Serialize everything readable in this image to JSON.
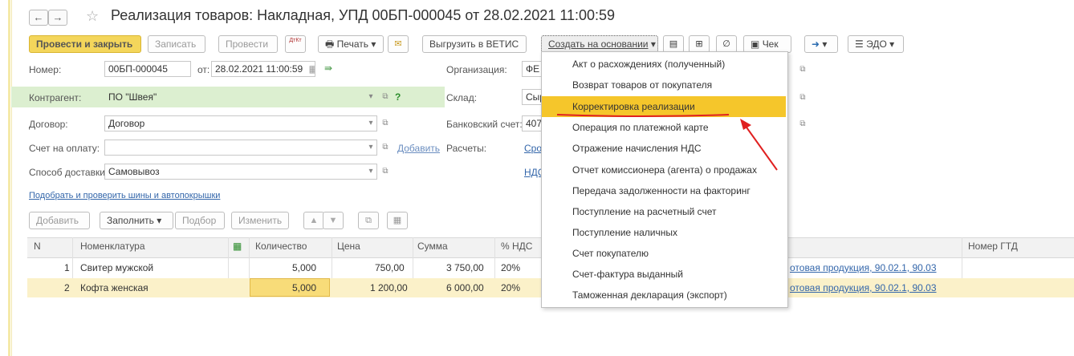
{
  "header": {
    "title": "Реализация товаров: Накладная, УПД 00БП-000045 от 28.02.2021 11:00:59",
    "back_arrow": "←",
    "forward_arrow": "→",
    "star_icon": "☆"
  },
  "toolbar": {
    "post_close": "Провести и закрыть",
    "save": "Записать",
    "post": "Провести",
    "dtkt": "ДтКт",
    "print": "Печать",
    "vetis": "Выгрузить в ВЕТИС",
    "create_based": "Создать на основании",
    "check": "Чек",
    "edo": "ЭДО"
  },
  "form": {
    "number_label": "Номер:",
    "number_value": "00БП-000045",
    "from_label": "от:",
    "date_value": "28.02.2021 11:00:59",
    "contractor_label": "Контрагент:",
    "contractor_value": "ПО \"Швея\"",
    "contract_label": "Договор:",
    "contract_value": "Договор",
    "invoice_label": "Счет на оплату:",
    "invoice_value": "",
    "add_link": "Добавить",
    "delivery_label": "Способ доставки:",
    "delivery_value": "Самовывоз",
    "tires_link": "Подобрать и проверить шины и автопокрышки",
    "org_label": "Организация:",
    "org_value": "ФЕ",
    "warehouse_label": "Склад:",
    "warehouse_value": "Сыр",
    "bank_label": "Банковский счет:",
    "bank_value": "407",
    "settlements_label": "Расчеты:",
    "settlements_link": "Сро",
    "vat_link": "НДС",
    "question": "?"
  },
  "table_toolbar": {
    "add": "Добавить",
    "fill": "Заполнить",
    "pick": "Подбор",
    "change": "Изменить"
  },
  "table": {
    "headers": {
      "n": "N",
      "item": "Номенклатура",
      "qty": "Количество",
      "price": "Цена",
      "sum": "Сумма",
      "vat": "% НДС",
      "gtd": "Номер ГТД"
    },
    "rows": [
      {
        "n": "1",
        "item": "Свитер мужской",
        "qty": "5,000",
        "price": "750,00",
        "sum": "3 750,00",
        "vat": "20%",
        "account": "отовая продукция, 90.02.1, 90.03"
      },
      {
        "n": "2",
        "item": "Кофта  женская",
        "qty": "5,000",
        "price": "1 200,00",
        "sum": "6 000,00",
        "vat": "20%",
        "account": "отовая продукция, 90.02.1, 90.03"
      }
    ]
  },
  "dropdown_menu": {
    "items": [
      "Акт о расхождениях (полученный)",
      "Возврат товаров от покупателя",
      "Корректировка реализации",
      "Операция по платежной карте",
      "Отражение начисления НДС",
      "Отчет комиссионера (агента) о продажах",
      "Передача задолженности на факторинг",
      "Поступление на расчетный счет",
      "Поступление наличных",
      "Счет покупателю",
      "Счет-фактура выданный",
      "Таможенная декларация (экспорт)"
    ],
    "selected_index": 2
  },
  "colors": {
    "accent": "#f4d65b",
    "highlight_row": "#dcefd0",
    "selected_item": "#f5c62b",
    "annotation": "#e02020"
  }
}
